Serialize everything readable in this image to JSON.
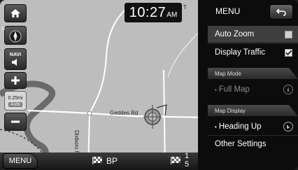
{
  "clock": {
    "time": "10:27",
    "ampm": "AM"
  },
  "map": {
    "streets": {
      "geddes": "Geddes Rd",
      "side": "Dixboro Rd",
      "top": "T"
    },
    "compass_letter": "N",
    "scale": {
      "value": "0.25mi",
      "mode": "Auto"
    },
    "navi_label": "NAVI"
  },
  "bottom_bar": {
    "menu_label": "MENU",
    "road_name": "BP",
    "distance_top": "1",
    "distance_bottom": "5"
  },
  "menu": {
    "title": "MENU",
    "items": {
      "auto_zoom": {
        "label": "Auto Zoom",
        "checked": false
      },
      "display_traffic": {
        "label": "Display Traffic",
        "checked": true
      },
      "map_mode_header": "Map Mode",
      "full_map": {
        "label": "Full Map",
        "enabled": false
      },
      "map_display_header": "Map Display",
      "heading_up": {
        "label": "Heading Up"
      },
      "other_settings": {
        "label": "Other Settings"
      }
    }
  },
  "icons": [
    "home-icon",
    "compass-icon",
    "speaker-icon",
    "plus-icon",
    "minus-icon",
    "back-arrow-icon",
    "checkered-flag-icon",
    "checkbox-icon",
    "compass-dial-icon"
  ],
  "colors": {
    "map_bg": "#bdbdbd",
    "river": "#6a6a6a",
    "road": "#ffffff",
    "panel": "#0c0c0c",
    "highlight": "#3e3e3e"
  }
}
